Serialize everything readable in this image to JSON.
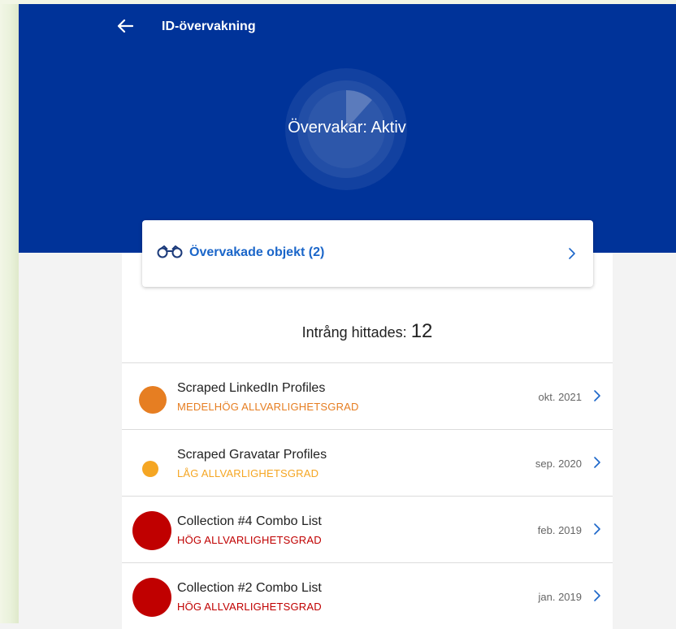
{
  "header": {
    "title": "ID-övervakning",
    "status": "Övervakar: Aktiv"
  },
  "monitored": {
    "label": "Övervakade objekt (2)"
  },
  "breaches": {
    "label": "Intrång hittades:",
    "count": "12",
    "items": [
      {
        "title": "Scraped LinkedIn Profiles",
        "severity": "MEDELHÖG ALLVARLIGHETSGRAD",
        "date": "okt. 2021",
        "color": "#e67e22"
      },
      {
        "title": "Scraped Gravatar Profiles",
        "severity": "LÅG ALLVARLIGHETSGRAD",
        "date": "sep. 2020",
        "color": "#f5a623"
      },
      {
        "title": "Collection #4 Combo List",
        "severity": "HÖG ALLVARLIGHETSGRAD",
        "date": "feb. 2019",
        "color": "#c00000"
      },
      {
        "title": "Collection #2 Combo List",
        "severity": "HÖG ALLVARLIGHETSGRAD",
        "date": "jan. 2019",
        "color": "#c00000"
      }
    ]
  },
  "colors": {
    "header_bg": "#003399",
    "link_blue": "#1b66c9",
    "chevron_blue": "#1b66c9"
  },
  "icons": [
    "back-arrow-icon",
    "radar-icon",
    "binoculars-icon",
    "chevron-right-icon"
  ]
}
